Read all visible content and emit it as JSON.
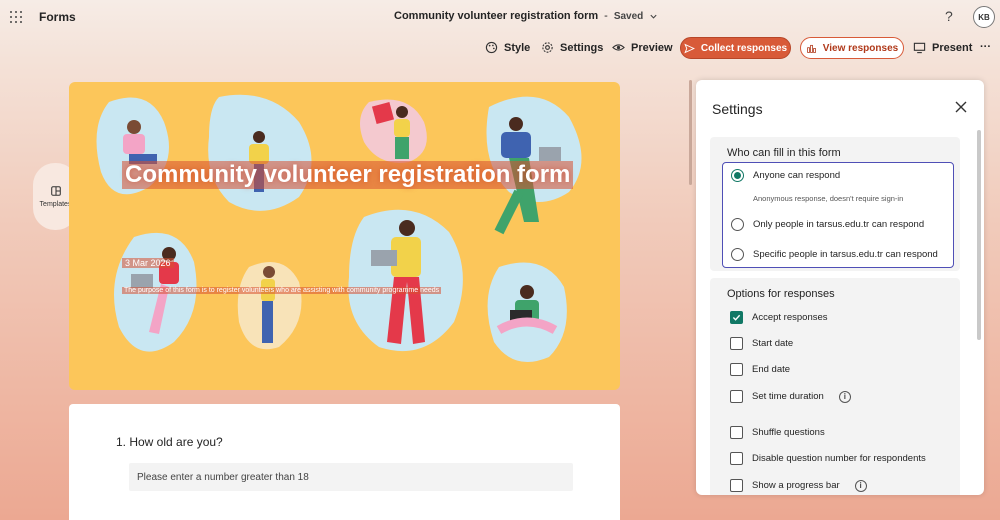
{
  "app": {
    "name": "Forms"
  },
  "header": {
    "doc_title": "Community volunteer registration form",
    "separator": "-",
    "saved_label": "Saved",
    "help": "?",
    "avatar_initials": "KB"
  },
  "toolbar": {
    "style": "Style",
    "settings": "Settings",
    "preview": "Preview",
    "collect": "Collect responses",
    "view": "View responses",
    "present": "Present",
    "more": "···"
  },
  "left_rail": {
    "templates": "Templates"
  },
  "form": {
    "title": "Community volunteer registration form",
    "date": "3 Mar 2026",
    "description": "The purpose of this form is to register volunteers who are assisting with community programme needs"
  },
  "questions": [
    {
      "title": "1. How old are you?",
      "placeholder": "Please enter a number greater than 18"
    }
  ],
  "settings": {
    "title": "Settings",
    "who_title": "Who can fill in this form",
    "who_options": [
      {
        "label": "Anyone can respond",
        "sub": "Anonymous response, doesn't require sign-in",
        "selected": true
      },
      {
        "label": "Only people in tarsus.edu.tr can respond",
        "selected": false
      },
      {
        "label": "Specific people in tarsus.edu.tr can respond",
        "selected": false
      }
    ],
    "options_title": "Options for responses",
    "options": [
      {
        "label": "Accept responses",
        "checked": true
      },
      {
        "label": "Start date",
        "checked": false
      },
      {
        "label": "End date",
        "checked": false
      },
      {
        "label": "Set time duration",
        "checked": false,
        "info": true
      },
      {
        "label": "Shuffle questions",
        "checked": false
      },
      {
        "label": "Disable question number for respondents",
        "checked": false
      },
      {
        "label": "Show a progress bar",
        "checked": false,
        "info": true
      }
    ]
  },
  "colors": {
    "accent": "#d85a38",
    "banner": "#fcc65a",
    "teal": "#117865",
    "focus": "#4f4fb6"
  }
}
